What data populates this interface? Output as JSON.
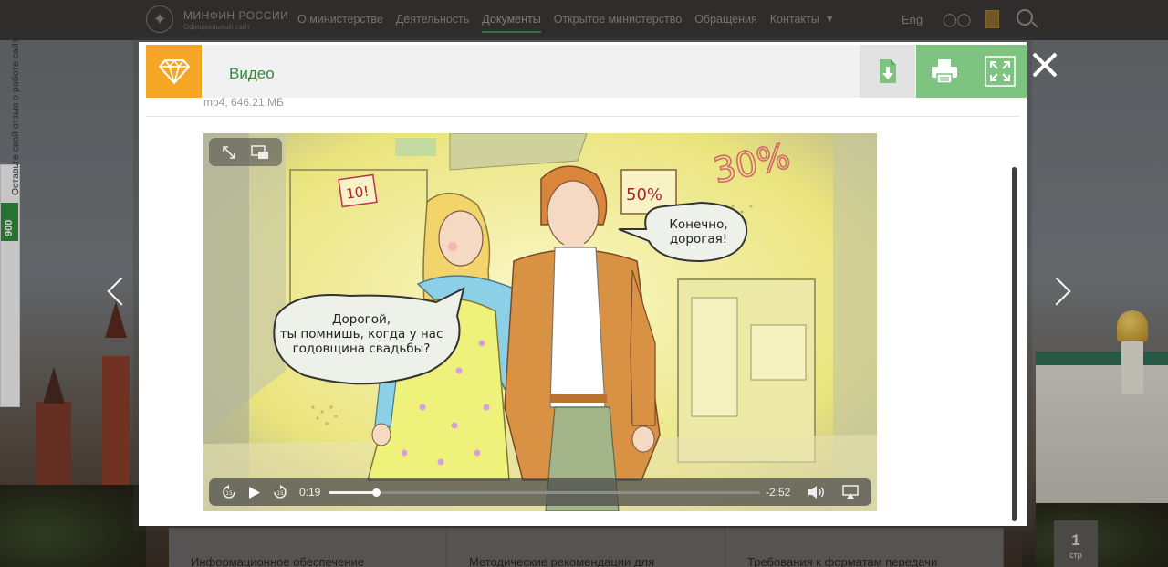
{
  "site": {
    "logo_title": "МИНФИН РОССИИ",
    "logo_subtitle": "Официальный сайт",
    "nav": [
      {
        "label": "О министерстве"
      },
      {
        "label": "Деятельность"
      },
      {
        "label": "Документы",
        "active": true
      },
      {
        "label": "Открытое министерство"
      },
      {
        "label": "Обращения"
      },
      {
        "label": "Контакты"
      }
    ],
    "lang": "Eng"
  },
  "feedback": {
    "label": "Оставьте свой отзыв о работе сайта",
    "badge": "900"
  },
  "background_cards": [
    {
      "label": "Информационное обеспечение"
    },
    {
      "label": "Методические рекомендации для"
    },
    {
      "label": "Требования к форматам передачи"
    }
  ],
  "page_counter": {
    "number": "1",
    "label": "стр"
  },
  "modal": {
    "title": "Видео",
    "file_meta": "mp4, 646.21 МБ",
    "colors": {
      "accent": "#f4a624",
      "green": "#7cc47f",
      "title": "#2e8b3c"
    }
  },
  "video": {
    "elapsed": "0:19",
    "remaining": "-2:52",
    "progress_fraction": 0.11,
    "bubble_left": [
      "Дорогой,",
      "ты помнишь, когда у нас",
      "годовщина свадьбы?"
    ],
    "bubble_right": [
      "Конечно,",
      "дорогая!"
    ],
    "sign_50": "50%",
    "sign_30": "30%",
    "sign_10": "10!"
  }
}
